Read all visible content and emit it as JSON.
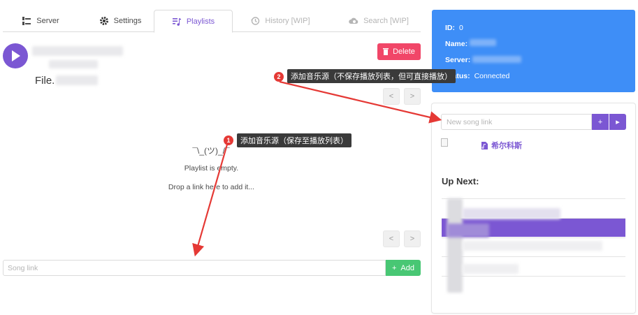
{
  "tabs": [
    {
      "label": "Server",
      "icon": "server-icon",
      "state": "normal"
    },
    {
      "label": "Settings",
      "icon": "gear-icon",
      "state": "normal"
    },
    {
      "label": "Playlists",
      "icon": "playlist-icon",
      "state": "active"
    },
    {
      "label": "History [WIP]",
      "icon": "history-icon",
      "state": "disabled"
    },
    {
      "label": "Search [WIP]",
      "icon": "search-cloud-icon",
      "state": "disabled"
    }
  ],
  "player": {
    "file_label": "File.",
    "delete_label": "Delete",
    "prev_label": "<",
    "next_label": ">"
  },
  "playlist": {
    "shrug": "¯\\_(ツ)_/¯",
    "empty_text": "Playlist is empty.",
    "drop_hint": "Drop a link here to add it...",
    "song_link_placeholder": "Song link",
    "add_label": "Add"
  },
  "info": {
    "id_label": "ID:",
    "id_value": "0",
    "name_label": "Name:",
    "server_label": "Server:",
    "status_label": "Status:",
    "status_value": "Connected"
  },
  "queue": {
    "new_song_placeholder": "New song link",
    "add_symbol": "+",
    "play_symbol": "▸",
    "current_title": "希尔科斯",
    "up_next_label": "Up Next:"
  },
  "annotations": {
    "badge1": "1",
    "tip1": "添加音乐源（保存至播放列表）",
    "badge2": "2",
    "tip2": "添加音乐源（不保存播放列表，但可直接播放）"
  },
  "colors": {
    "accent": "#7b57d3",
    "info": "#3e8ef7",
    "danger": "#f14668",
    "success": "#48c774",
    "annotation": "#e53935"
  }
}
